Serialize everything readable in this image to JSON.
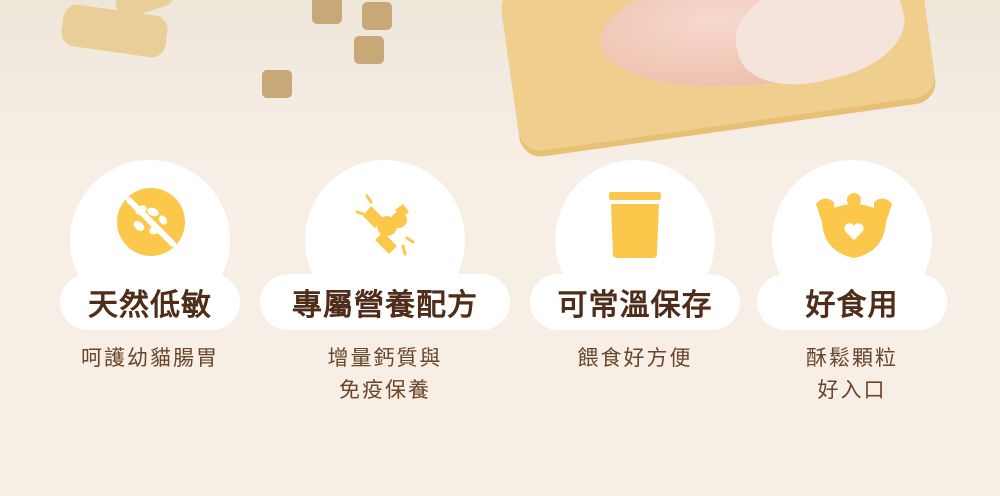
{
  "features": [
    {
      "title": "天然低敏",
      "desc_lines": [
        "呵護幼貓腸胃"
      ],
      "icon": "no-grain-icon"
    },
    {
      "title": "專屬營養配方",
      "desc_lines": [
        "增量鈣質與",
        "免疫保養"
      ],
      "icon": "joint-bone-icon"
    },
    {
      "title": "可常溫保存",
      "desc_lines": [
        "餵食好方便"
      ],
      "icon": "food-pouch-icon"
    },
    {
      "title": "好食用",
      "desc_lines": [
        "酥鬆顆粒",
        "好入口"
      ],
      "icon": "cat-heart-icon"
    }
  ],
  "colors": {
    "accent": "#fbc84c",
    "text": "#4f2d18",
    "background": "#f7efe6"
  }
}
